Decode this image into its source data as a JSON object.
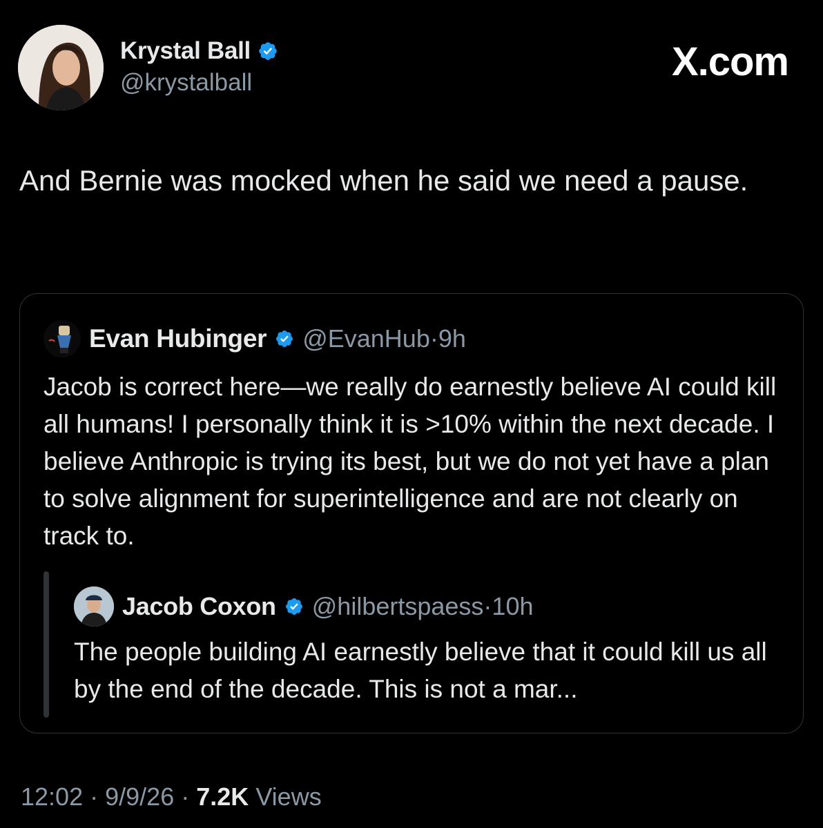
{
  "author": {
    "display_name": "Krystal Ball",
    "handle": "@krystalball"
  },
  "brand": "X.com",
  "tweet": {
    "text": "And Bernie was mocked when he said we need a pause."
  },
  "quote": {
    "display_name": "Evan Hubinger",
    "handle": "@EvanHub",
    "time": "9h",
    "text": "Jacob is correct here—we really do earnestly believe AI could kill all humans! I personally think it is >10% within the next decade. I believe Anthropic is trying its best, but we do not yet have a plan to solve alignment for superintelligence and are not clearly on track to.",
    "nested": {
      "display_name": "Jacob Coxon",
      "handle": "@hilbertspaess",
      "time": "10h",
      "text": "The people building AI earnestly believe that it could kill us all by the end of the decade. This is not a mar..."
    }
  },
  "meta": {
    "time": "12:02",
    "date": "9/9/26",
    "views_count": "7.2K",
    "views_label": "Views",
    "separator": "·"
  },
  "icons": {
    "verified": "verified-badge-icon"
  },
  "colors": {
    "background": "#000000",
    "text": "#e7e9ea",
    "secondary": "#8b98a5",
    "verified_blue": "#1d9bf0",
    "border": "#2f3336"
  }
}
